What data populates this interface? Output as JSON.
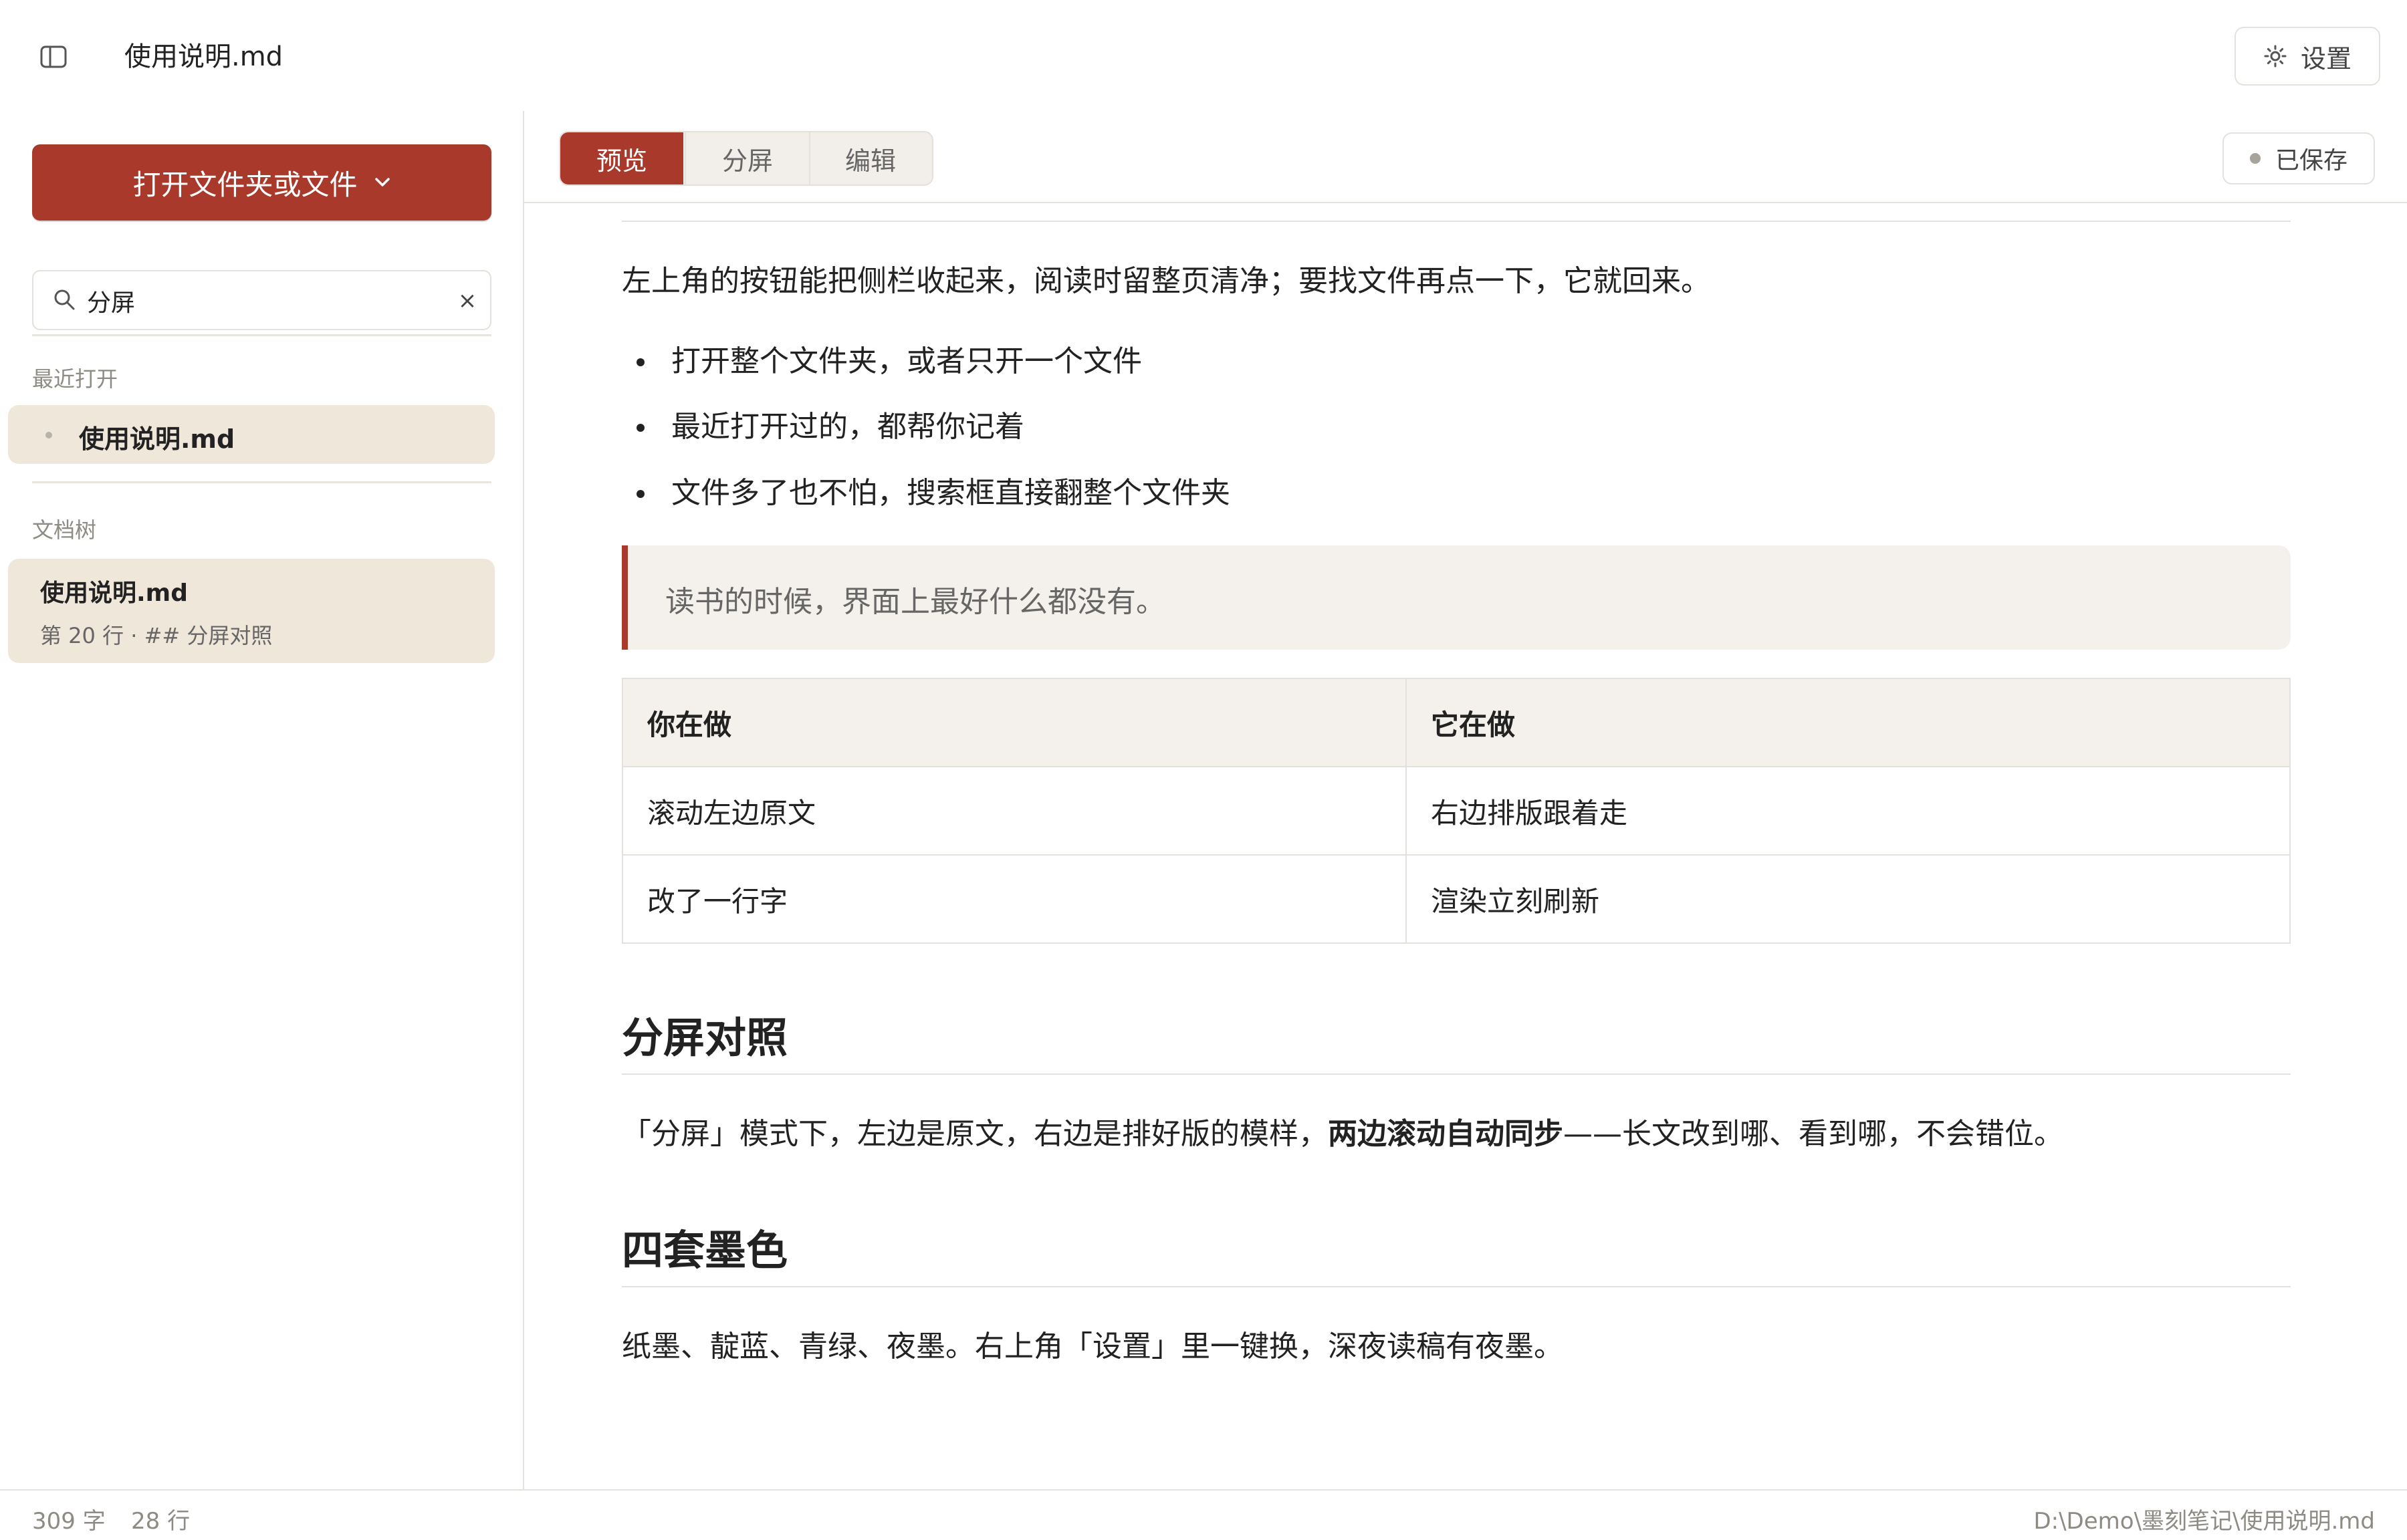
{
  "header": {
    "doc_title": "使用说明.md",
    "settings_label": "设置"
  },
  "sidebar": {
    "open_button_label": "打开文件夹或文件",
    "search": {
      "value": "分屏",
      "clear_glyph": "×"
    },
    "recent_label": "最近打开",
    "recent_items": [
      {
        "label": "使用说明.md"
      }
    ],
    "tree_label": "文档树",
    "tree_items": [
      {
        "title": "使用说明.md",
        "subtitle": "第 20 行 · ## 分屏对照"
      }
    ]
  },
  "toolbar": {
    "tabs": [
      {
        "label": "预览",
        "active": true
      },
      {
        "label": "分屏",
        "active": false
      },
      {
        "label": "编辑",
        "active": false
      }
    ],
    "saved_label": "已保存"
  },
  "content": {
    "intro": "左上角的按钮能把侧栏收起来，阅读时留整页清净；要找文件再点一下，它就回来。",
    "bullets": [
      "打开整个文件夹，或者只开一个文件",
      "最近打开过的，都帮你记着",
      "文件多了也不怕，搜索框直接翻整个文件夹"
    ],
    "quote": "读书的时候，界面上最好什么都没有。",
    "table": {
      "headers": [
        "你在做",
        "它在做"
      ],
      "rows": [
        [
          "滚动左边原文",
          "右边排版跟着走"
        ],
        [
          "改了一行字",
          "渲染立刻刷新"
        ]
      ]
    },
    "section_split": {
      "heading": "分屏对照",
      "text_before": "「分屏」模式下，左边是原文，右边是排好版的模样，",
      "text_bold": "两边滚动自动同步",
      "text_after": "——长文改到哪、看到哪，不会错位。"
    },
    "section_ink": {
      "heading": "四套墨色",
      "text": "纸墨、靛蓝、青绿、夜墨。右上角「设置」里一键换，深夜读稿有夜墨。"
    }
  },
  "status": {
    "word_count": "309 字",
    "line_count": "28 行",
    "file_path": "D:\\Demo\\墨刻笔记\\使用说明.md"
  },
  "colors": {
    "accent": "#a8392b",
    "selected_bg": "#efe7da",
    "quote_bg": "#f4f1ec",
    "border": "#e4e1dc",
    "muted_text": "#8e8a84"
  },
  "icons": {
    "sidebar_toggle": "sidebar-panel-icon",
    "settings": "sun-gear-icon",
    "open_dropdown": "chevron-down-icon",
    "search": "search-icon"
  }
}
